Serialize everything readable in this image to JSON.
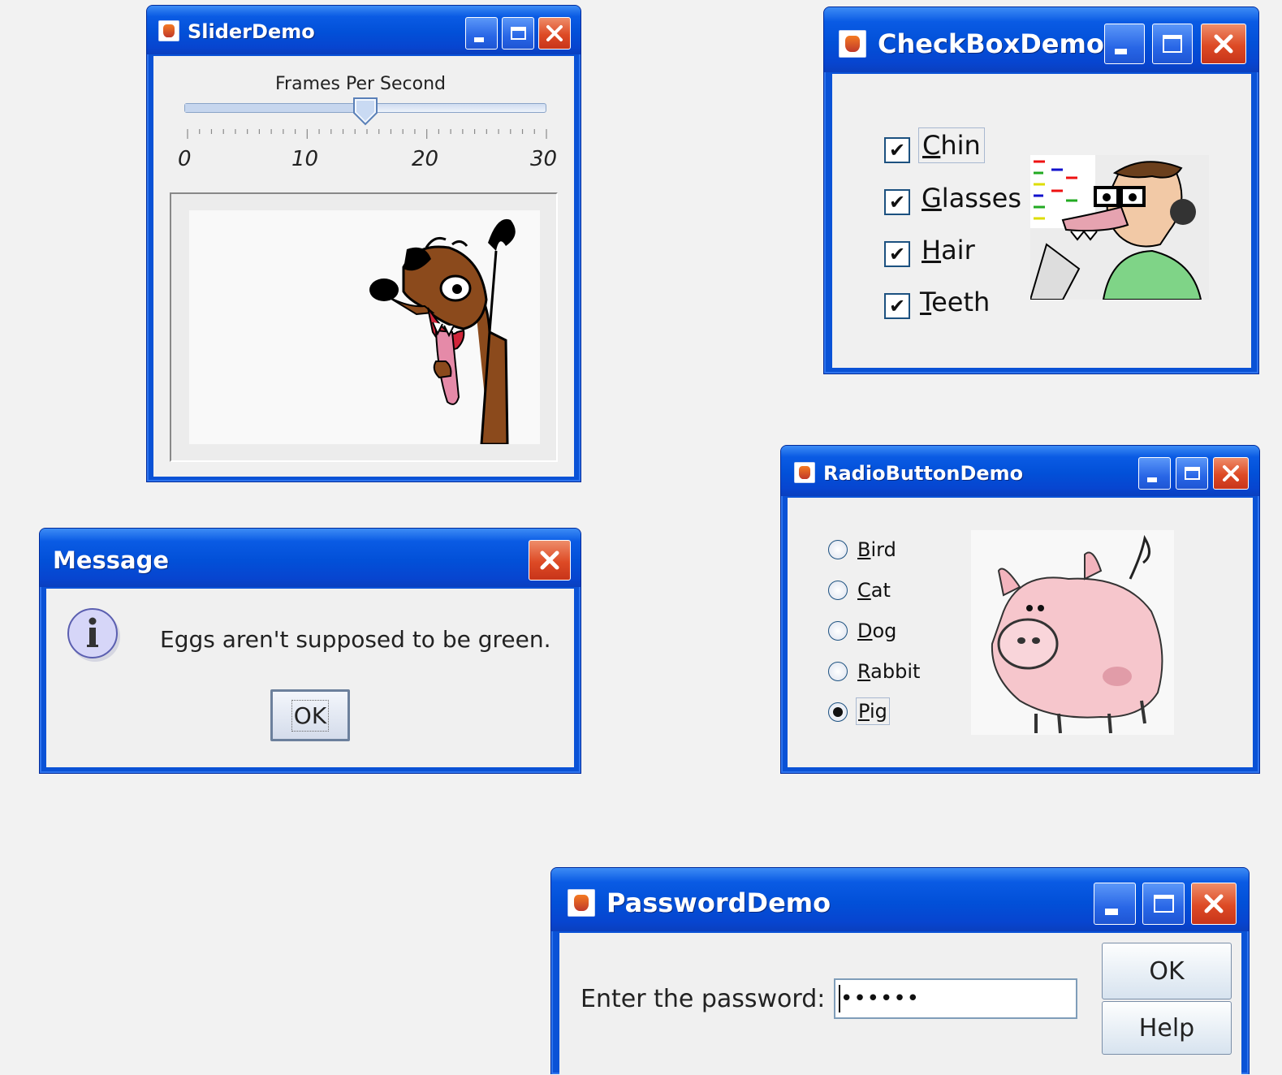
{
  "slider_demo": {
    "title": "SliderDemo",
    "slider_label": "Frames Per Second",
    "ticks": [
      "0",
      "10",
      "20",
      "30"
    ],
    "slider_value": 15,
    "slider_min": 0,
    "slider_max": 30
  },
  "checkbox_demo": {
    "title": "CheckBoxDemo",
    "items": [
      {
        "label": "Chin",
        "mnemonic": "C",
        "checked": true
      },
      {
        "label": "Glasses",
        "mnemonic": "G",
        "checked": true
      },
      {
        "label": "Hair",
        "mnemonic": "H",
        "checked": true
      },
      {
        "label": "Teeth",
        "mnemonic": "T",
        "checked": true
      }
    ],
    "check_glyph": "✔"
  },
  "message_dialog": {
    "title": "Message",
    "icon": "information-icon",
    "text": "Eggs aren't supposed to be green.",
    "ok_label": "OK"
  },
  "radio_demo": {
    "title": "RadioButtonDemo",
    "options": [
      {
        "label": "Bird",
        "selected": false
      },
      {
        "label": "Cat",
        "selected": false
      },
      {
        "label": "Dog",
        "selected": false
      },
      {
        "label": "Rabbit",
        "selected": false
      },
      {
        "label": "Pig",
        "selected": true
      }
    ]
  },
  "password_demo": {
    "title": "PasswordDemo",
    "prompt": "Enter the password:",
    "masked_value": "••••••",
    "ok_label": "OK",
    "help_label": "Help"
  },
  "colors": {
    "xp_blue": "#0a52d6",
    "close_red": "#dd4a25",
    "panel_gray": "#f0f0f0"
  }
}
